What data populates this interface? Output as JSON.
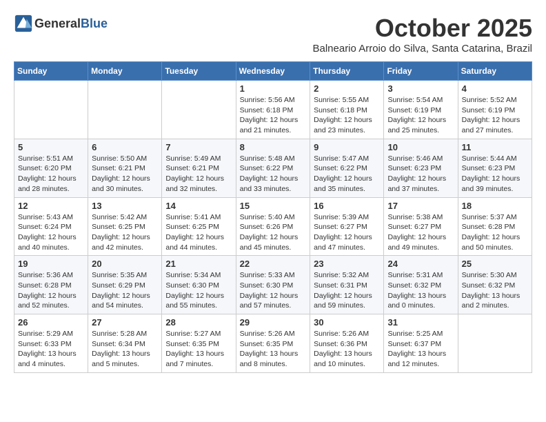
{
  "header": {
    "logo_general": "General",
    "logo_blue": "Blue",
    "month": "October 2025",
    "location": "Balneario Arroio do Silva, Santa Catarina, Brazil"
  },
  "weekdays": [
    "Sunday",
    "Monday",
    "Tuesday",
    "Wednesday",
    "Thursday",
    "Friday",
    "Saturday"
  ],
  "weeks": [
    [
      {
        "day": "",
        "info": ""
      },
      {
        "day": "",
        "info": ""
      },
      {
        "day": "",
        "info": ""
      },
      {
        "day": "1",
        "info": "Sunrise: 5:56 AM\nSunset: 6:18 PM\nDaylight: 12 hours\nand 21 minutes."
      },
      {
        "day": "2",
        "info": "Sunrise: 5:55 AM\nSunset: 6:18 PM\nDaylight: 12 hours\nand 23 minutes."
      },
      {
        "day": "3",
        "info": "Sunrise: 5:54 AM\nSunset: 6:19 PM\nDaylight: 12 hours\nand 25 minutes."
      },
      {
        "day": "4",
        "info": "Sunrise: 5:52 AM\nSunset: 6:19 PM\nDaylight: 12 hours\nand 27 minutes."
      }
    ],
    [
      {
        "day": "5",
        "info": "Sunrise: 5:51 AM\nSunset: 6:20 PM\nDaylight: 12 hours\nand 28 minutes."
      },
      {
        "day": "6",
        "info": "Sunrise: 5:50 AM\nSunset: 6:21 PM\nDaylight: 12 hours\nand 30 minutes."
      },
      {
        "day": "7",
        "info": "Sunrise: 5:49 AM\nSunset: 6:21 PM\nDaylight: 12 hours\nand 32 minutes."
      },
      {
        "day": "8",
        "info": "Sunrise: 5:48 AM\nSunset: 6:22 PM\nDaylight: 12 hours\nand 33 minutes."
      },
      {
        "day": "9",
        "info": "Sunrise: 5:47 AM\nSunset: 6:22 PM\nDaylight: 12 hours\nand 35 minutes."
      },
      {
        "day": "10",
        "info": "Sunrise: 5:46 AM\nSunset: 6:23 PM\nDaylight: 12 hours\nand 37 minutes."
      },
      {
        "day": "11",
        "info": "Sunrise: 5:44 AM\nSunset: 6:23 PM\nDaylight: 12 hours\nand 39 minutes."
      }
    ],
    [
      {
        "day": "12",
        "info": "Sunrise: 5:43 AM\nSunset: 6:24 PM\nDaylight: 12 hours\nand 40 minutes."
      },
      {
        "day": "13",
        "info": "Sunrise: 5:42 AM\nSunset: 6:25 PM\nDaylight: 12 hours\nand 42 minutes."
      },
      {
        "day": "14",
        "info": "Sunrise: 5:41 AM\nSunset: 6:25 PM\nDaylight: 12 hours\nand 44 minutes."
      },
      {
        "day": "15",
        "info": "Sunrise: 5:40 AM\nSunset: 6:26 PM\nDaylight: 12 hours\nand 45 minutes."
      },
      {
        "day": "16",
        "info": "Sunrise: 5:39 AM\nSunset: 6:27 PM\nDaylight: 12 hours\nand 47 minutes."
      },
      {
        "day": "17",
        "info": "Sunrise: 5:38 AM\nSunset: 6:27 PM\nDaylight: 12 hours\nand 49 minutes."
      },
      {
        "day": "18",
        "info": "Sunrise: 5:37 AM\nSunset: 6:28 PM\nDaylight: 12 hours\nand 50 minutes."
      }
    ],
    [
      {
        "day": "19",
        "info": "Sunrise: 5:36 AM\nSunset: 6:28 PM\nDaylight: 12 hours\nand 52 minutes."
      },
      {
        "day": "20",
        "info": "Sunrise: 5:35 AM\nSunset: 6:29 PM\nDaylight: 12 hours\nand 54 minutes."
      },
      {
        "day": "21",
        "info": "Sunrise: 5:34 AM\nSunset: 6:30 PM\nDaylight: 12 hours\nand 55 minutes."
      },
      {
        "day": "22",
        "info": "Sunrise: 5:33 AM\nSunset: 6:30 PM\nDaylight: 12 hours\nand 57 minutes."
      },
      {
        "day": "23",
        "info": "Sunrise: 5:32 AM\nSunset: 6:31 PM\nDaylight: 12 hours\nand 59 minutes."
      },
      {
        "day": "24",
        "info": "Sunrise: 5:31 AM\nSunset: 6:32 PM\nDaylight: 13 hours\nand 0 minutes."
      },
      {
        "day": "25",
        "info": "Sunrise: 5:30 AM\nSunset: 6:32 PM\nDaylight: 13 hours\nand 2 minutes."
      }
    ],
    [
      {
        "day": "26",
        "info": "Sunrise: 5:29 AM\nSunset: 6:33 PM\nDaylight: 13 hours\nand 4 minutes."
      },
      {
        "day": "27",
        "info": "Sunrise: 5:28 AM\nSunset: 6:34 PM\nDaylight: 13 hours\nand 5 minutes."
      },
      {
        "day": "28",
        "info": "Sunrise: 5:27 AM\nSunset: 6:35 PM\nDaylight: 13 hours\nand 7 minutes."
      },
      {
        "day": "29",
        "info": "Sunrise: 5:26 AM\nSunset: 6:35 PM\nDaylight: 13 hours\nand 8 minutes."
      },
      {
        "day": "30",
        "info": "Sunrise: 5:26 AM\nSunset: 6:36 PM\nDaylight: 13 hours\nand 10 minutes."
      },
      {
        "day": "31",
        "info": "Sunrise: 5:25 AM\nSunset: 6:37 PM\nDaylight: 13 hours\nand 12 minutes."
      },
      {
        "day": "",
        "info": ""
      }
    ]
  ]
}
